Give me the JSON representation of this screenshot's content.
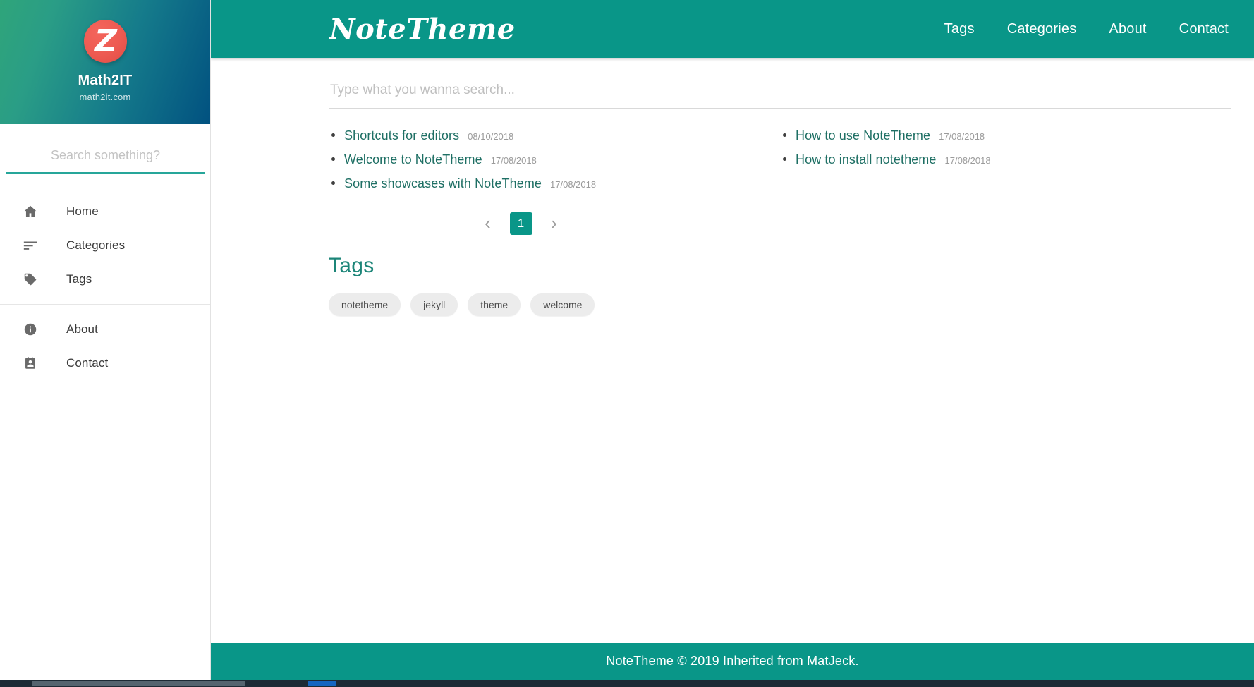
{
  "sidebar": {
    "logo_icon": "z-logo-icon",
    "logo_letter": "Z",
    "site_title": "Math2IT",
    "site_url": "math2it.com",
    "search_placeholder": "Search something?",
    "search_value": "",
    "nav_items": [
      {
        "label": "Home",
        "icon": "home-icon"
      },
      {
        "label": "Categories",
        "icon": "list-lines-icon"
      },
      {
        "label": "Tags",
        "icon": "tag-icon"
      },
      {
        "label": "About",
        "icon": "info-circle-icon"
      },
      {
        "label": "Contact",
        "icon": "contact-card-icon"
      }
    ]
  },
  "topbar": {
    "brand": "NoteTheme",
    "nav": [
      {
        "label": "Tags"
      },
      {
        "label": "Categories"
      },
      {
        "label": "About"
      },
      {
        "label": "Contact"
      }
    ]
  },
  "main": {
    "search_placeholder": "Type what you wanna search...",
    "search_value": "",
    "posts_left": [
      {
        "title": "Shortcuts for editors",
        "date": "08/10/2018"
      },
      {
        "title": "Welcome to NoteTheme",
        "date": "17/08/2018"
      },
      {
        "title": "Some showcases with NoteTheme",
        "date": "17/08/2018"
      }
    ],
    "posts_right": [
      {
        "title": "How to use NoteTheme",
        "date": "17/08/2018"
      },
      {
        "title": "How to install notetheme",
        "date": "17/08/2018"
      }
    ],
    "pagination": {
      "prev_icon": "chevron-left-icon",
      "next_icon": "chevron-right-icon",
      "prev_glyph": "‹",
      "next_glyph": "›",
      "current_page": "1"
    },
    "tags_heading": "Tags",
    "tags": [
      "notetheme",
      "jekyll",
      "theme",
      "welcome"
    ]
  },
  "footer": {
    "text": "NoteTheme © 2019 Inherited from MatJeck."
  },
  "colors": {
    "teal": "#099688",
    "teal_dark": "#1c8578",
    "link": "#1e6f64",
    "logo_red": "#ed5a51",
    "sidebar_gradient_start": "#2fa57a",
    "sidebar_gradient_end": "#015180",
    "chip_bg": "#ececec"
  }
}
